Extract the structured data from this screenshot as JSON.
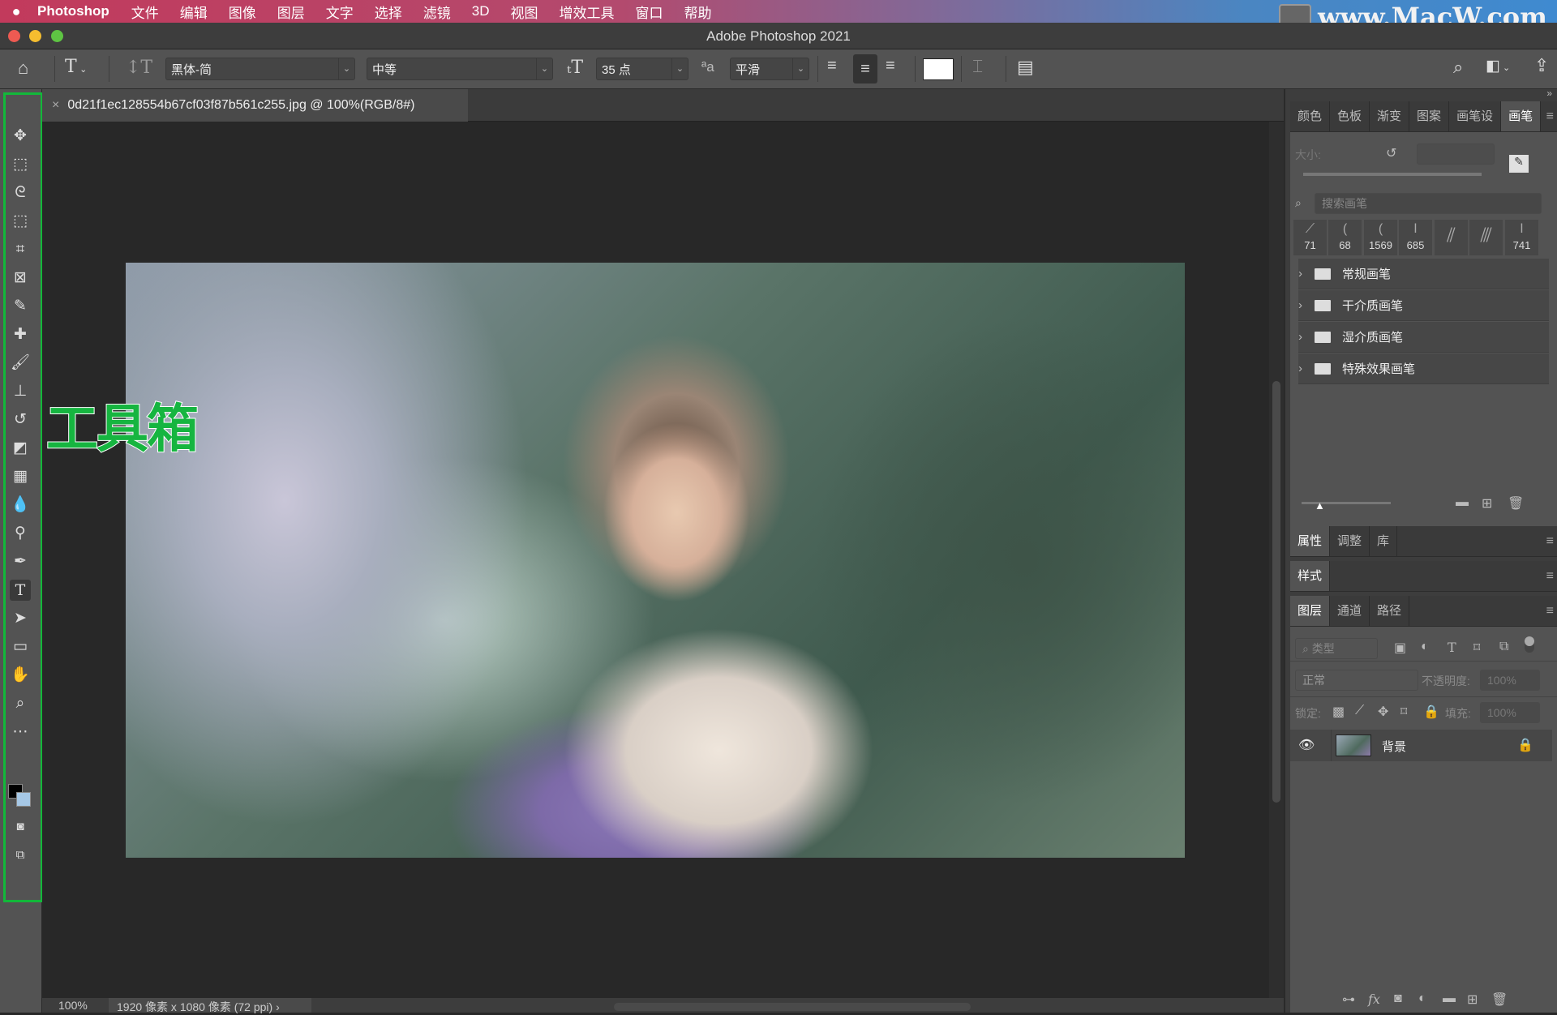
{
  "menubar": {
    "apple": "",
    "app": "Photoshop",
    "items": [
      "文件",
      "编辑",
      "图像",
      "图层",
      "文字",
      "选择",
      "滤镜",
      "3D",
      "视图",
      "增效工具",
      "窗口",
      "帮助"
    ],
    "watermark": "www.MacW.com"
  },
  "window": {
    "title": "Adobe Photoshop 2021"
  },
  "options": {
    "font_family": "黑体-简",
    "font_style": "中等",
    "font_size": "35 点",
    "antialias": "平滑",
    "text_color": "#ffffff"
  },
  "document": {
    "tab_title": "0d21f1ec128554b67cf03f87b561c255.jpg @ 100%(RGB/8#)",
    "close": "×"
  },
  "annotation": {
    "label": "工具箱",
    "color": "#12b83a"
  },
  "status": {
    "zoom": "100%",
    "info": "1920 像素 x 1080 像素 (72 ppi)",
    "arrow": "›"
  },
  "brushes_panel": {
    "tabs": [
      "颜色",
      "色板",
      "渐变",
      "图案",
      "画笔设",
      "画笔"
    ],
    "active_tab": "画笔",
    "size_label": "大小:",
    "search_placeholder": "搜索画笔",
    "presets": [
      "71",
      "68",
      "1569",
      "685",
      "",
      "",
      "741"
    ],
    "folders": [
      "常规画笔",
      "干介质画笔",
      "湿介质画笔",
      "特殊效果画笔"
    ]
  },
  "properties_panel": {
    "tabs": [
      "属性",
      "调整",
      "库"
    ]
  },
  "styles_panel": {
    "tabs": [
      "样式"
    ]
  },
  "layers_panel": {
    "tabs": [
      "图层",
      "通道",
      "路径"
    ],
    "filter_label": "类型",
    "blend_mode": "正常",
    "opacity_label": "不透明度:",
    "opacity": "100%",
    "lock_label": "锁定:",
    "fill_label": "填充:",
    "fill": "100%",
    "layers": [
      {
        "name": "背景",
        "visible": true,
        "locked": true
      }
    ]
  }
}
